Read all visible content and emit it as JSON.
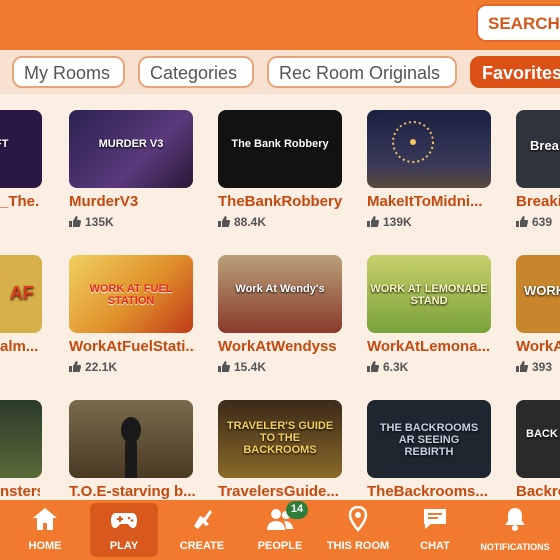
{
  "header": {
    "search_label": "SEARCH R"
  },
  "tabs": [
    {
      "label": "My Rooms"
    },
    {
      "label": "Categories"
    },
    {
      "label": "Rec Room Originals"
    },
    {
      "label": "Favorites"
    }
  ],
  "rooms": [
    {
      "title": "_The...",
      "likes": "",
      "thumb_text": "THE SHIFT",
      "color": "#2a1746"
    },
    {
      "title": "MurderV3",
      "likes": "135K",
      "thumb_text": "MURDER V3",
      "color": "#3a2a5c"
    },
    {
      "title": "TheBankRobbery",
      "likes": "88.4K",
      "thumb_text": "The Bank Robbery",
      "color": "#141414"
    },
    {
      "title": "MakeItToMidni...",
      "likes": "139K",
      "thumb_text": "",
      "color": "#1d2340"
    },
    {
      "title": "Breaki",
      "likes": "639",
      "thumb_text": "Brea",
      "color": "#30343c"
    },
    {
      "title": "alm...",
      "likes": "",
      "thumb_text": "AF",
      "color": "#d8b04a"
    },
    {
      "title": "WorkAtFuelStati...",
      "likes": "22.1K",
      "thumb_text": "WORK AT FUEL STATION",
      "color": "#e0a030"
    },
    {
      "title": "WorkAtWendyss",
      "likes": "15.4K",
      "thumb_text": "Work At Wendy's",
      "color": "#8a3a2a"
    },
    {
      "title": "WorkAtLemona...",
      "likes": "6.3K",
      "thumb_text": "WORK AT LEMONADE STAND",
      "color": "#7aa23a"
    },
    {
      "title": "WorkA",
      "likes": "393",
      "thumb_text": "WORK AT",
      "color": "#c8862c"
    },
    {
      "title": "nsters",
      "likes": "",
      "thumb_text": "",
      "color": "#5a6b3a"
    },
    {
      "title": "T.O.E-starving b...",
      "likes": "",
      "thumb_text": "",
      "color": "#6a5a3c"
    },
    {
      "title": "TravelersGuide...",
      "likes": "",
      "thumb_text": "TRAVELER'S GUIDE TO THE BACKROOMS",
      "color": "#3a2a18"
    },
    {
      "title": "TheBackrooms...",
      "likes": "",
      "thumb_text": "THE BACKROOMS AR SEEING REBIRTH",
      "color": "#1e2630"
    },
    {
      "title": "Backro",
      "likes": "",
      "thumb_text": "BACK",
      "color": "#2a2a2a"
    }
  ],
  "nav": [
    {
      "label": "HOME",
      "icon": "home-icon"
    },
    {
      "label": "PLAY",
      "icon": "gamepad-icon"
    },
    {
      "label": "CREATE",
      "icon": "create-icon"
    },
    {
      "label": "PEOPLE",
      "icon": "people-icon"
    },
    {
      "label": "THIS ROOM",
      "icon": "location-pin-icon"
    },
    {
      "label": "CHAT",
      "icon": "chat-icon"
    },
    {
      "label": "NOTIFICATIONS",
      "icon": "bell-icon"
    }
  ],
  "people_badge": "14",
  "colors": {
    "accent": "#f27a2e",
    "active": "#dc4f15",
    "title": "#c44a10",
    "background": "#fbeee3"
  }
}
